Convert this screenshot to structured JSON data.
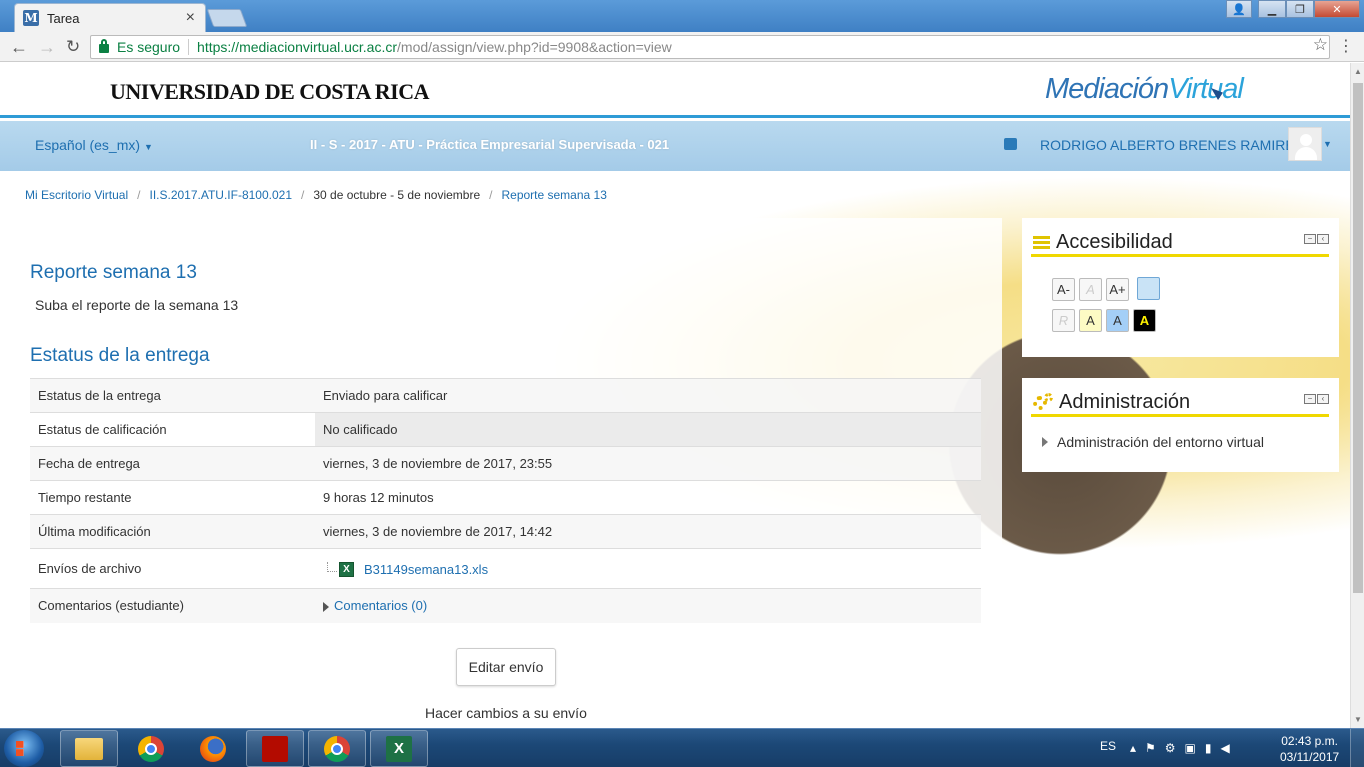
{
  "browser": {
    "tab_title": "Tarea",
    "tab_favicon": "M",
    "secure_label": "Es seguro",
    "url_host": "https://mediacionvirtual.ucr.ac.cr",
    "url_path": "/mod/assign/view.php?id=9908&action=view"
  },
  "header": {
    "ucr_logo": "UNIVERSIDAD DE COSTA RICA",
    "mv_logo_1": "Mediación",
    "mv_logo_2": "Virtual"
  },
  "navbar": {
    "language": "Español (es_mx)",
    "course_title": "II - S - 2017 - ATU - Práctica Empresarial Supervisada - 021",
    "username": "RODRIGO ALBERTO BRENES RAMIREZ"
  },
  "breadcrumb": [
    "Mi Escritorio Virtual",
    "II.S.2017.ATU.IF-8100.021",
    "30 de octubre - 5 de noviembre",
    "Reporte semana 13"
  ],
  "assignment": {
    "title": "Reporte semana 13",
    "description": "Suba el reporte de la semana 13",
    "status_heading": "Estatus de la entrega",
    "rows": [
      {
        "label": "Estatus de la entrega",
        "value": "Enviado para calificar"
      },
      {
        "label": "Estatus de calificación",
        "value": "No calificado"
      },
      {
        "label": "Fecha de entrega",
        "value": "viernes, 3 de noviembre de 2017, 23:55"
      },
      {
        "label": "Tiempo restante",
        "value": "9 horas 12 minutos"
      },
      {
        "label": "Última modificación",
        "value": "viernes, 3 de noviembre de 2017, 14:42"
      },
      {
        "label": "Envíos de archivo",
        "value": "B31149semana13.xls"
      },
      {
        "label": "Comentarios (estudiante)",
        "value": "Comentarios (0)"
      }
    ],
    "edit_button": "Editar envío",
    "edit_hint": "Hacer cambios a su envío"
  },
  "blocks": {
    "accessibility": {
      "title": "Accesibilidad",
      "buttons": [
        "A-",
        "A",
        "A+",
        "R",
        "A",
        "A",
        "A"
      ]
    },
    "administration": {
      "title": "Administración",
      "item": "Administración del entorno virtual"
    }
  },
  "taskbar": {
    "lang": "ES",
    "time": "02:43 p.m.",
    "date": "03/11/2017"
  },
  "colors": {
    "link": "#1e6fb0",
    "status_ok": "#cfefcf",
    "header_rule": "#2e9bd6",
    "block_accent": "#f0d800"
  }
}
